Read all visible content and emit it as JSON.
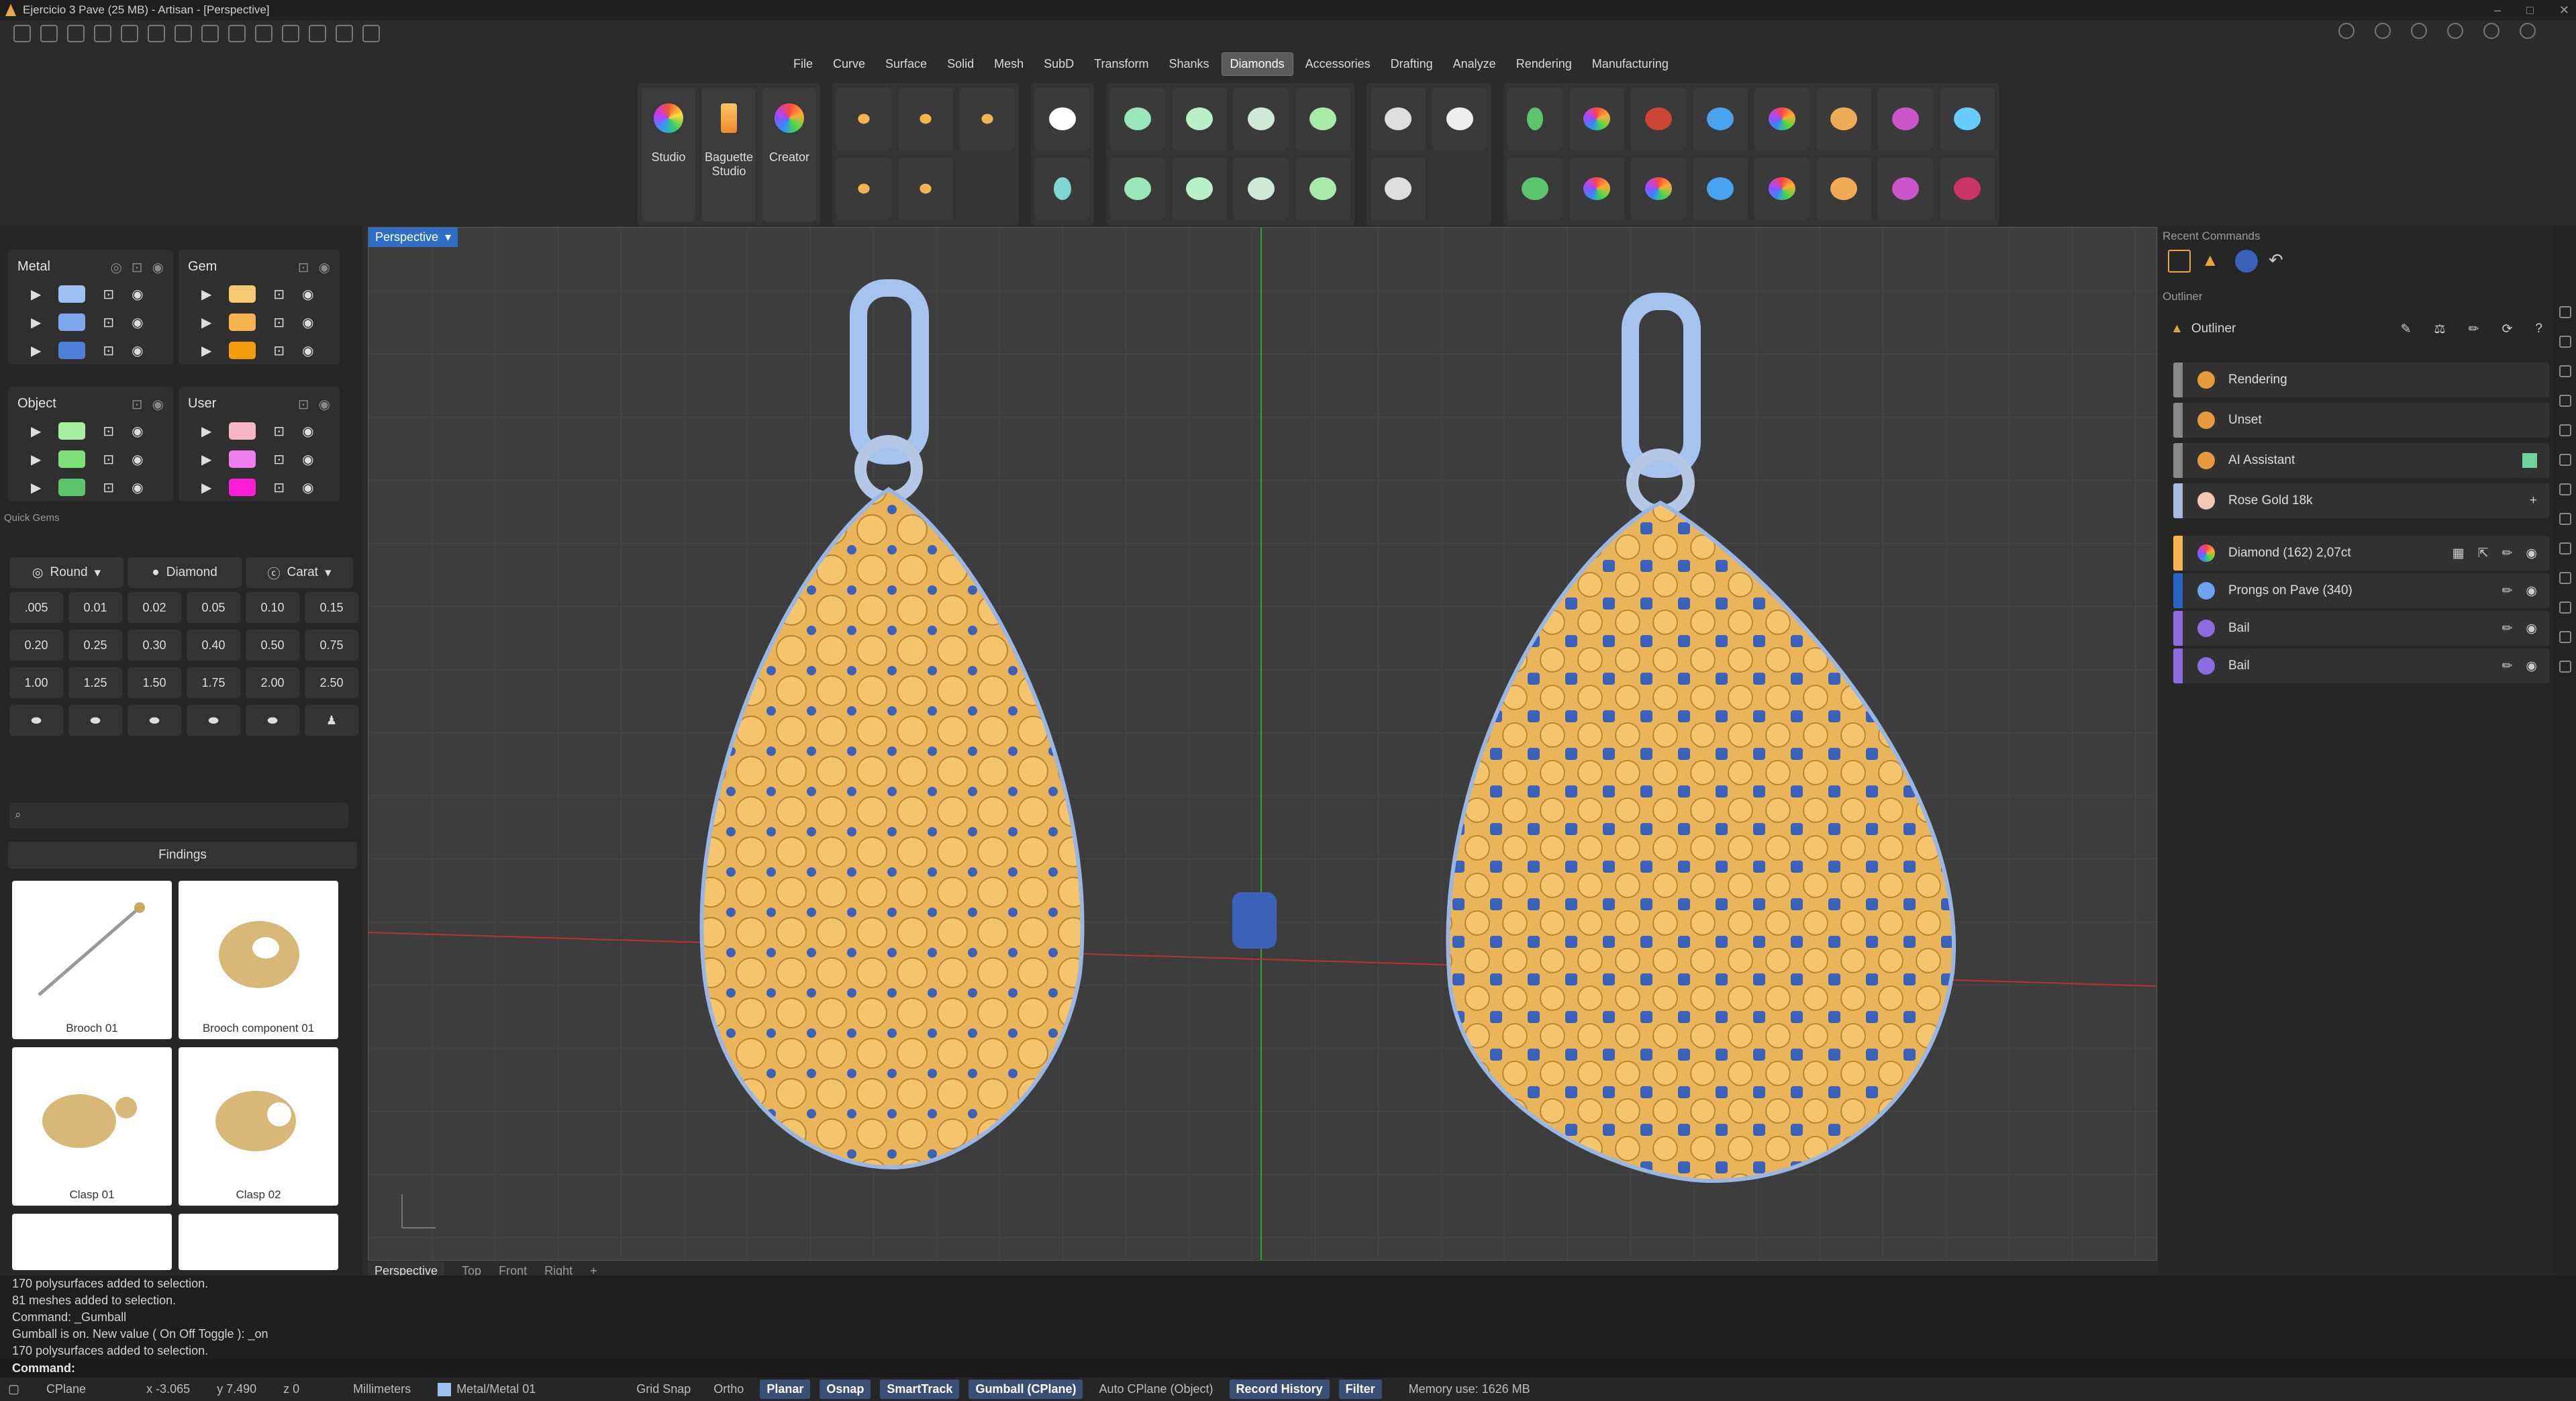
{
  "window": {
    "title": "Ejercicio 3 Pave (25 MB) - Artisan - [Perspective]"
  },
  "menu": {
    "tabs": [
      "File",
      "Curve",
      "Surface",
      "Solid",
      "Mesh",
      "SubD",
      "Transform",
      "Shanks",
      "Diamonds",
      "Accessories",
      "Drafting",
      "Analyze",
      "Rendering",
      "Manufacturing"
    ],
    "active": "Diamonds"
  },
  "ribbon": {
    "studio": "Studio",
    "baguette": "Baguette Studio",
    "creator": "Creator"
  },
  "layers": {
    "metal": {
      "title": "Metal",
      "colors": [
        "#9ec1f4",
        "#7fa6ec",
        "#4e7fd8"
      ]
    },
    "gem": {
      "title": "Gem",
      "colors": [
        "#f7c872",
        "#f5b450",
        "#f59e0b"
      ]
    },
    "object": {
      "title": "Object",
      "colors": [
        "#a6ef9e",
        "#7ee07a",
        "#5cc46a"
      ]
    },
    "user": {
      "title": "User",
      "colors": [
        "#f7b6c6",
        "#f07ef0",
        "#ff1ed8"
      ]
    }
  },
  "quick_gems": {
    "title": "Quick Gems",
    "shape": "Round",
    "material": "Diamond",
    "unit": "Carat",
    "sizes": [
      ".005",
      "0.01",
      "0.02",
      "0.05",
      "0.10",
      "0.15",
      "0.20",
      "0.25",
      "0.30",
      "0.40",
      "0.50",
      "0.75",
      "1.00",
      "1.25",
      "1.50",
      "1.75",
      "2.00",
      "2.50"
    ]
  },
  "findings": {
    "title": "Findings",
    "items": [
      "Brooch 01",
      "Brooch component 01",
      "Clasp 01",
      "Clasp 02"
    ]
  },
  "viewport": {
    "name": "Perspective",
    "tabs": [
      "Perspective",
      "Top",
      "Front",
      "Right"
    ],
    "add": "+"
  },
  "right": {
    "recent_title": "Recent Commands",
    "outliner_section": "Outliner",
    "outliner_title": "Outliner",
    "materials": [
      {
        "label": "Rendering",
        "color": "#e59b3a"
      },
      {
        "label": "Unset",
        "color": "#e59b3a"
      },
      {
        "label": "AI Assistant",
        "color": "#e59b3a"
      },
      {
        "label": "Rose Gold 18k",
        "color": "#f2c9b4"
      }
    ],
    "objects": [
      {
        "label": "Diamond (162) 2,07ct",
        "bar": "#f5b450"
      },
      {
        "label": "Prongs on Pave (340)",
        "bar": "#2a64c7"
      },
      {
        "label": "Bail",
        "bar": "#8c6de0"
      },
      {
        "label": "Bail",
        "bar": "#8c6de0"
      }
    ],
    "plus": "+"
  },
  "command": {
    "history": [
      "170 polysurfaces added to selection.",
      "81 meshes added to selection.",
      "Command: _Gumball",
      "Gumball is on. New value ( On  Off  Toggle ): _on",
      "170 polysurfaces added to selection."
    ],
    "prompt": "Command:"
  },
  "status": {
    "cplane": "CPlane",
    "x": "x -3.065",
    "y": "y 7.490",
    "z": "z 0",
    "units": "Millimeters",
    "layer": "Metal/Metal 01",
    "gridsnap": "Grid Snap",
    "ortho": "Ortho",
    "planar": "Planar",
    "osnap": "Osnap",
    "smarttrack": "SmartTrack",
    "gumball": "Gumball (CPlane)",
    "autocplane": "Auto CPlane (Object)",
    "history": "Record History",
    "filter": "Filter",
    "memory": "Memory use: 1626 MB"
  }
}
